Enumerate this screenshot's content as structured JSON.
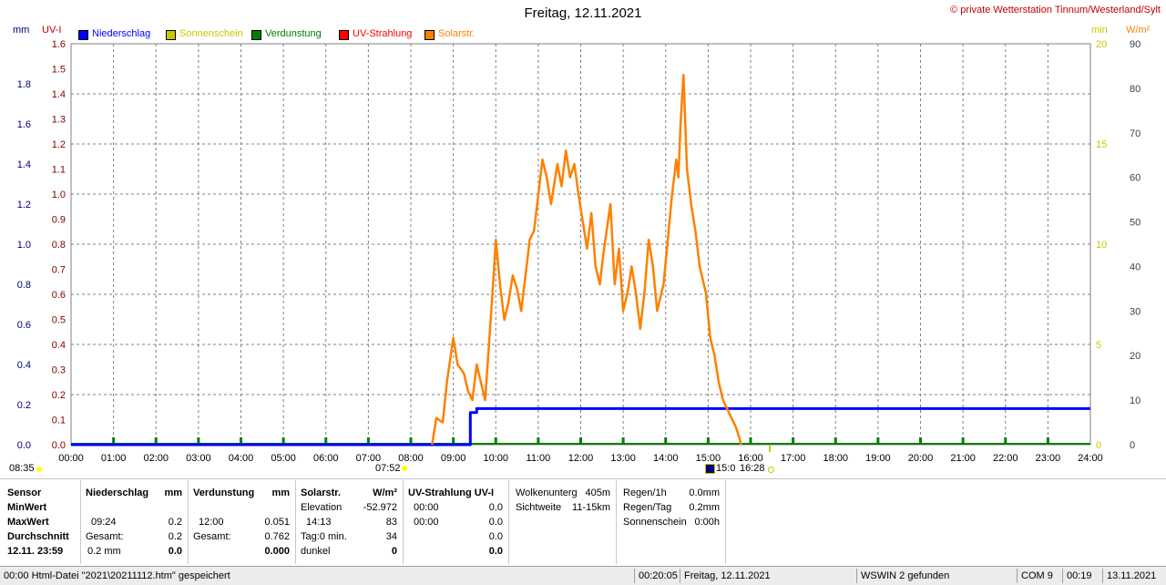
{
  "header": {
    "title": "Freitag, 12.11.2021",
    "copyright": "© private Wetterstation Tinnum/Westerland/Sylt",
    "left_unit_mm": "mm",
    "left_unit_uv": "UV-I",
    "right_unit_min": "min",
    "right_unit_wm2": "W/m²"
  },
  "legend": [
    {
      "label": "Niederschlag",
      "color": "#0000ff"
    },
    {
      "label": "Sonnenschein",
      "color": "#c8c800"
    },
    {
      "label": "Verdunstung",
      "color": "#008000"
    },
    {
      "label": "UV-Strahlung",
      "color": "#ff0000"
    },
    {
      "label": "Solarstr.",
      "color": "#ff8000"
    }
  ],
  "chart_data": {
    "type": "line",
    "title": "Freitag, 12.11.2021",
    "x_ticks": [
      "00:00",
      "01:00",
      "02:00",
      "03:00",
      "04:00",
      "05:00",
      "06:00",
      "07:00",
      "08:00",
      "09:00",
      "10:00",
      "11:00",
      "12:00",
      "13:00",
      "14:00",
      "15:00",
      "16:00",
      "17:00",
      "18:00",
      "19:00",
      "20:00",
      "21:00",
      "22:00",
      "23:00",
      "24:00"
    ],
    "axis_mm_ticks": [
      "0.0",
      "0.2",
      "0.4",
      "0.6",
      "0.8",
      "1.0",
      "1.2",
      "1.4",
      "1.6",
      "1.8"
    ],
    "axis_uv_ticks": [
      "0.0",
      "0.1",
      "0.2",
      "0.3",
      "0.4",
      "0.5",
      "0.6",
      "0.7",
      "0.8",
      "0.9",
      "1.0",
      "1.1",
      "1.2",
      "1.3",
      "1.4",
      "1.5",
      "1.6"
    ],
    "axis_min_ticks": [
      "0",
      "5",
      "10",
      "15",
      "20"
    ],
    "axis_wm2_ticks": [
      "0",
      "10",
      "20",
      "30",
      "40",
      "50",
      "60",
      "70",
      "80",
      "90"
    ],
    "ylim_mm": [
      0,
      2.0
    ],
    "ylim_uv": [
      0,
      1.6
    ],
    "ylim_min": [
      0,
      20
    ],
    "ylim_wm2": [
      0,
      90
    ],
    "grid": true,
    "series": [
      {
        "name": "Niederschlag",
        "unit": "mm",
        "color": "#0000ff",
        "points": [
          [
            0,
            0
          ],
          [
            9.4,
            0
          ],
          [
            9.4,
            0.16
          ],
          [
            9.55,
            0.16
          ],
          [
            9.55,
            0.18
          ],
          [
            24,
            0.18
          ]
        ]
      },
      {
        "name": "Solarstr.",
        "unit": "W/m²",
        "color": "#ff8000",
        "points": [
          [
            8.5,
            0
          ],
          [
            8.6,
            6
          ],
          [
            8.75,
            5
          ],
          [
            8.85,
            14
          ],
          [
            9.0,
            24
          ],
          [
            9.1,
            18
          ],
          [
            9.25,
            16
          ],
          [
            9.35,
            12
          ],
          [
            9.45,
            10
          ],
          [
            9.55,
            18
          ],
          [
            9.65,
            14
          ],
          [
            9.75,
            10
          ],
          [
            9.85,
            24
          ],
          [
            9.95,
            38
          ],
          [
            10.0,
            46
          ],
          [
            10.1,
            36
          ],
          [
            10.2,
            28
          ],
          [
            10.3,
            32
          ],
          [
            10.4,
            38
          ],
          [
            10.5,
            35
          ],
          [
            10.6,
            30
          ],
          [
            10.7,
            38
          ],
          [
            10.8,
            46
          ],
          [
            10.9,
            48
          ],
          [
            11.0,
            56
          ],
          [
            11.1,
            64
          ],
          [
            11.2,
            60
          ],
          [
            11.3,
            54
          ],
          [
            11.45,
            63
          ],
          [
            11.55,
            58
          ],
          [
            11.65,
            66
          ],
          [
            11.75,
            60
          ],
          [
            11.85,
            63
          ],
          [
            11.95,
            56
          ],
          [
            12.05,
            50
          ],
          [
            12.15,
            44
          ],
          [
            12.25,
            52
          ],
          [
            12.35,
            40
          ],
          [
            12.45,
            36
          ],
          [
            12.55,
            44
          ],
          [
            12.7,
            54
          ],
          [
            12.8,
            36
          ],
          [
            12.9,
            44
          ],
          [
            13.0,
            30
          ],
          [
            13.1,
            34
          ],
          [
            13.2,
            40
          ],
          [
            13.3,
            34
          ],
          [
            13.4,
            26
          ],
          [
            13.5,
            34
          ],
          [
            13.6,
            46
          ],
          [
            13.7,
            40
          ],
          [
            13.8,
            30
          ],
          [
            13.95,
            36
          ],
          [
            14.05,
            46
          ],
          [
            14.15,
            56
          ],
          [
            14.25,
            64
          ],
          [
            14.3,
            60
          ],
          [
            14.35,
            72
          ],
          [
            14.42,
            83
          ],
          [
            14.5,
            62
          ],
          [
            14.6,
            54
          ],
          [
            14.7,
            48
          ],
          [
            14.8,
            40
          ],
          [
            14.95,
            34
          ],
          [
            15.05,
            24
          ],
          [
            15.15,
            20
          ],
          [
            15.25,
            14
          ],
          [
            15.35,
            10
          ],
          [
            15.45,
            8
          ],
          [
            15.55,
            6
          ],
          [
            15.65,
            4
          ],
          [
            15.72,
            2
          ],
          [
            15.78,
            0
          ]
        ]
      }
    ],
    "marker_labels": {
      "sunrise": "07:52",
      "sunset": "15:0",
      "dark": "16:28",
      "left_time": "08:35"
    }
  },
  "panels": {
    "sensor": {
      "header": "Sensor",
      "rows": [
        "MinWert",
        "MaxWert",
        "Durchschnitt",
        "12.11.  23:59"
      ]
    },
    "niederschlag": {
      "header": "Niederschlag",
      "unit": "mm",
      "rows": [
        [
          "",
          ""
        ],
        [
          "09:24",
          "0.2"
        ],
        [
          "Gesamt:",
          "0.2"
        ],
        [
          "0.2 mm",
          "0.0"
        ]
      ]
    },
    "verdunstung": {
      "header": "Verdunstung",
      "unit": "mm",
      "rows": [
        [
          "",
          ""
        ],
        [
          "12:00",
          "0.051"
        ],
        [
          "Gesamt:",
          "0.762"
        ],
        [
          "",
          "0.000"
        ]
      ]
    },
    "solar": {
      "header": "Solarstr.",
      "unit": "W/m²",
      "rows": [
        [
          "Elevation",
          "-52.972"
        ],
        [
          "14:13",
          "83"
        ],
        [
          "Tag:0 min.",
          "34"
        ],
        [
          "dunkel",
          "0"
        ]
      ]
    },
    "uv": {
      "header": "UV-Strahlung UV-I",
      "rows": [
        [
          "00:00",
          "0.0"
        ],
        [
          "00:00",
          "0.0"
        ],
        [
          "",
          "0.0"
        ],
        [
          "",
          "0.0"
        ]
      ]
    },
    "wolken": {
      "rows": [
        [
          "Wolkenunterg",
          "405m"
        ],
        [
          "Sichtweite",
          "11-15km"
        ]
      ]
    },
    "regen": {
      "rows": [
        [
          "Regen/1h",
          "0.0mm"
        ],
        [
          "Regen/Tag",
          "0.2mm"
        ],
        [
          "Sonnenschein",
          "0:00h"
        ]
      ]
    }
  },
  "statusbar": {
    "left": "00:00  Html-Datei  \"2021\\20211112.htm\"  gespeichert",
    "time": "00:20:05",
    "date": "Freitag, 12.11.2021",
    "wswin": "WSWIN 2 gefunden",
    "com": "COM 9",
    "clock": "00:19",
    "date2": "13.11.2021"
  }
}
